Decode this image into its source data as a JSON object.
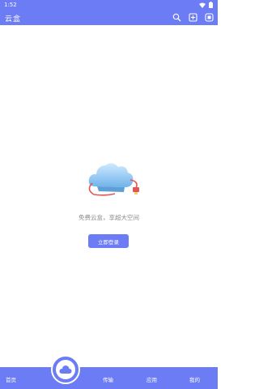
{
  "colors": {
    "accent": "#6b7cf5"
  },
  "status_bar": {
    "time": "1:52",
    "icons": [
      "wifi-icon",
      "battery-icon"
    ]
  },
  "header": {
    "title": "云盒",
    "actions": [
      "search-icon",
      "upload-icon",
      "scan-icon"
    ]
  },
  "main": {
    "promo_text": "免费云盒，享超大空间",
    "login_button": "立即登录",
    "illustration": "cloud-cable-illustration"
  },
  "tabbar": {
    "tabs": [
      {
        "label": "首页",
        "icon": ""
      },
      {
        "label": "",
        "icon": "cloud-icon"
      },
      {
        "label": "传输",
        "icon": ""
      },
      {
        "label": "应用",
        "icon": ""
      },
      {
        "label": "我的",
        "icon": ""
      }
    ]
  }
}
